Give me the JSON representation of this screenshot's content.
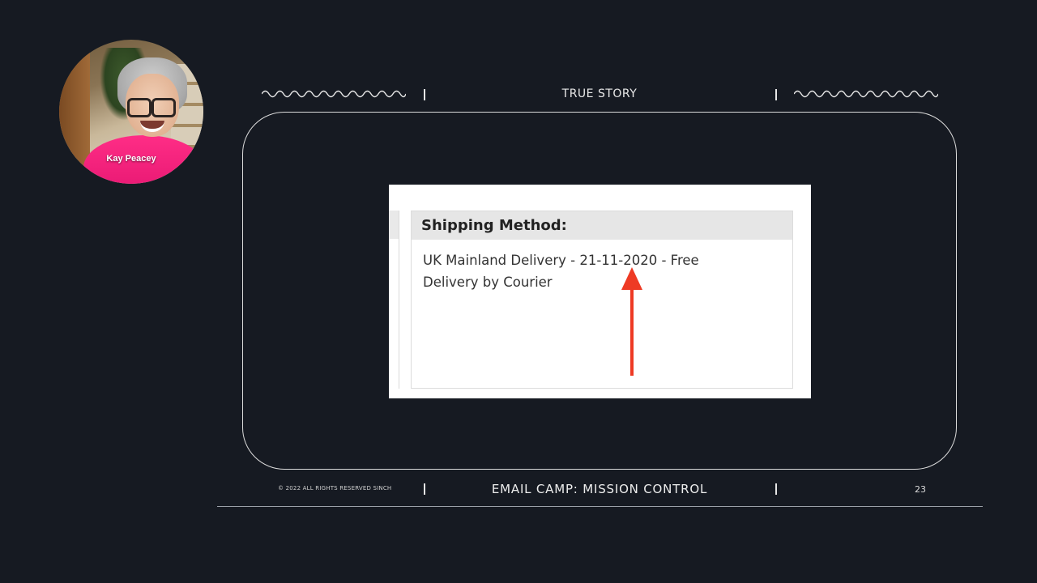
{
  "speaker": {
    "name": "Kay Peacey"
  },
  "slide": {
    "header_title": "TRUE STORY",
    "footer_copyright": "© 2022 ALL RIGHTS RESERVED SINCH",
    "footer_title": "EMAIL CAMP: MISSION CONTROL",
    "page_number": "23"
  },
  "email_snippet": {
    "heading": "Shipping Method:",
    "line1": "UK Mainland Delivery - 21-11-2020 - Free",
    "line2": "Delivery by Courier"
  },
  "colors": {
    "background": "#161a22",
    "arrow": "#ee3a24",
    "speaker_shirt": "#ff2d86"
  }
}
